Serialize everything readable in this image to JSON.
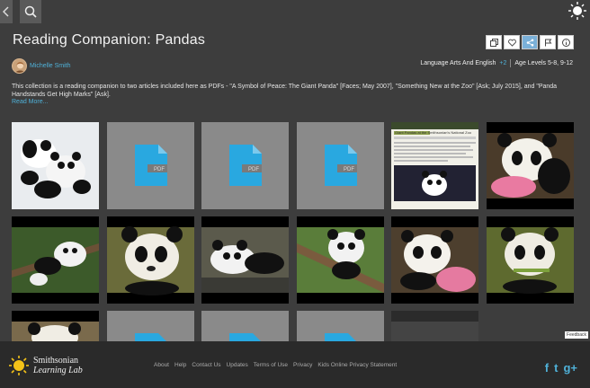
{
  "header": {
    "title": "Reading Companion: Pandas",
    "author": "Michelle Smith",
    "subject": "Language Arts And English",
    "subject_more": "+2",
    "age": "Age Levels 5-8, 9-12"
  },
  "description": {
    "text": "This collection is a reading companion to two articles included here as PDFs - \"A Symbol of Peace: The Giant Panda\" [Faces; May 2007], \"Something New at the Zoo\" [Ask; July 2015], and \"Panda Handstands Get High Marks\" [Ask].",
    "read_more": "Read More..."
  },
  "tiles": [
    {
      "kind": "photo",
      "label": "pandas-in-snow-photo"
    },
    {
      "kind": "pdf",
      "badge": "PDF"
    },
    {
      "kind": "pdf",
      "badge": "PDF"
    },
    {
      "kind": "pdf",
      "badge": "PDF"
    },
    {
      "kind": "webpage",
      "label": "Giant Pandas at the Smithsonian's National Zoo"
    },
    {
      "kind": "photo",
      "label": "panda-cub-on-pink-ball-photo"
    },
    {
      "kind": "photo",
      "label": "panda-on-branch-photo"
    },
    {
      "kind": "photo",
      "label": "panda-cub-face-photo"
    },
    {
      "kind": "photo",
      "label": "panda-cub-lying-photo"
    },
    {
      "kind": "photo",
      "label": "panda-in-tree-photo"
    },
    {
      "kind": "photo",
      "label": "panda-cub-with-ball-photo"
    },
    {
      "kind": "photo",
      "label": "panda-eating-bamboo-photo"
    },
    {
      "kind": "photo",
      "label": "panda-partial-photo"
    },
    {
      "kind": "pdf",
      "badge": ""
    },
    {
      "kind": "pdf",
      "badge": ""
    },
    {
      "kind": "pdf",
      "badge": ""
    },
    {
      "kind": "photo",
      "label": "dark-photo"
    }
  ],
  "footer": {
    "brand_line1": "Smithsonian",
    "brand_line2": "Learning Lab",
    "links": [
      "About",
      "Help",
      "Contact Us",
      "Updates",
      "Terms of Use",
      "Privacy",
      "Kids Online Privacy Statement"
    ],
    "social": [
      "f",
      "t",
      "g+"
    ],
    "feedback": "Feedback"
  },
  "colors": {
    "accent": "#4fb1d8",
    "pdf_blue": "#29a8e0",
    "bg": "#3d3d3d"
  }
}
